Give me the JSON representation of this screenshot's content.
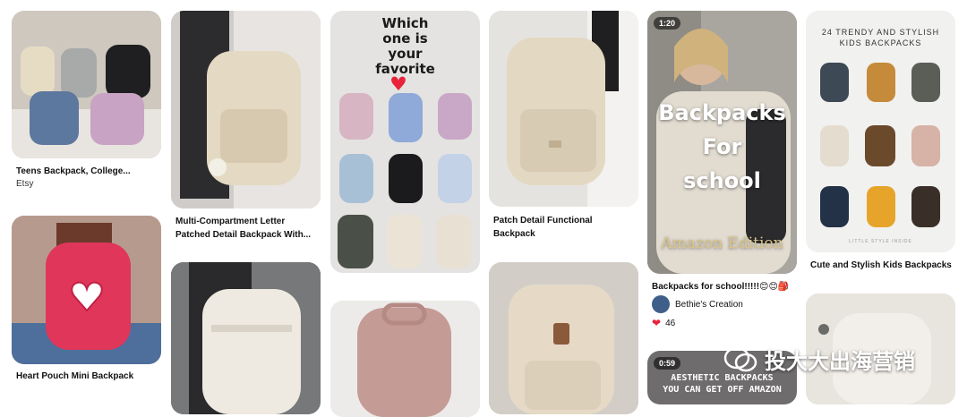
{
  "pins": {
    "p1": {
      "title": "Teens Backpack, College...",
      "source": "Etsy"
    },
    "p2": {
      "title": "Heart Pouch Mini Backpack"
    },
    "p3": {
      "title": "Multi-Compartment Letter Patched Detail Backpack With..."
    },
    "p5": {
      "text": [
        "Which",
        "one is",
        "your",
        "favorite"
      ]
    },
    "p7": {
      "title": "Patch Detail Functional Backpack"
    },
    "p9": {
      "duration": "1:20",
      "overlay": [
        "Backpacks",
        "For",
        "school"
      ],
      "overlay_sub": "Amazon Edition",
      "title": "Backpacks for school!!!!!😊😊🎒",
      "creator": "Bethie's Creation",
      "likes": "46"
    },
    "p10": {
      "duration": "0:59",
      "overlay": [
        "AESTHETIC BACKPACKS",
        "YOU CAN GET OFF AMAZON"
      ]
    },
    "p11": {
      "header": "24 TRENDY AND STYLISH KIDS BACKPACKS",
      "footer": "LITTLE STYLE INSIDE",
      "title": "Cute and Stylish Kids Backpacks"
    }
  },
  "watermark": {
    "text": "投大大出海营销"
  },
  "colors": {
    "pin_gray": "#e9e9e9",
    "text": "#111111",
    "heart": "#e8233a"
  }
}
